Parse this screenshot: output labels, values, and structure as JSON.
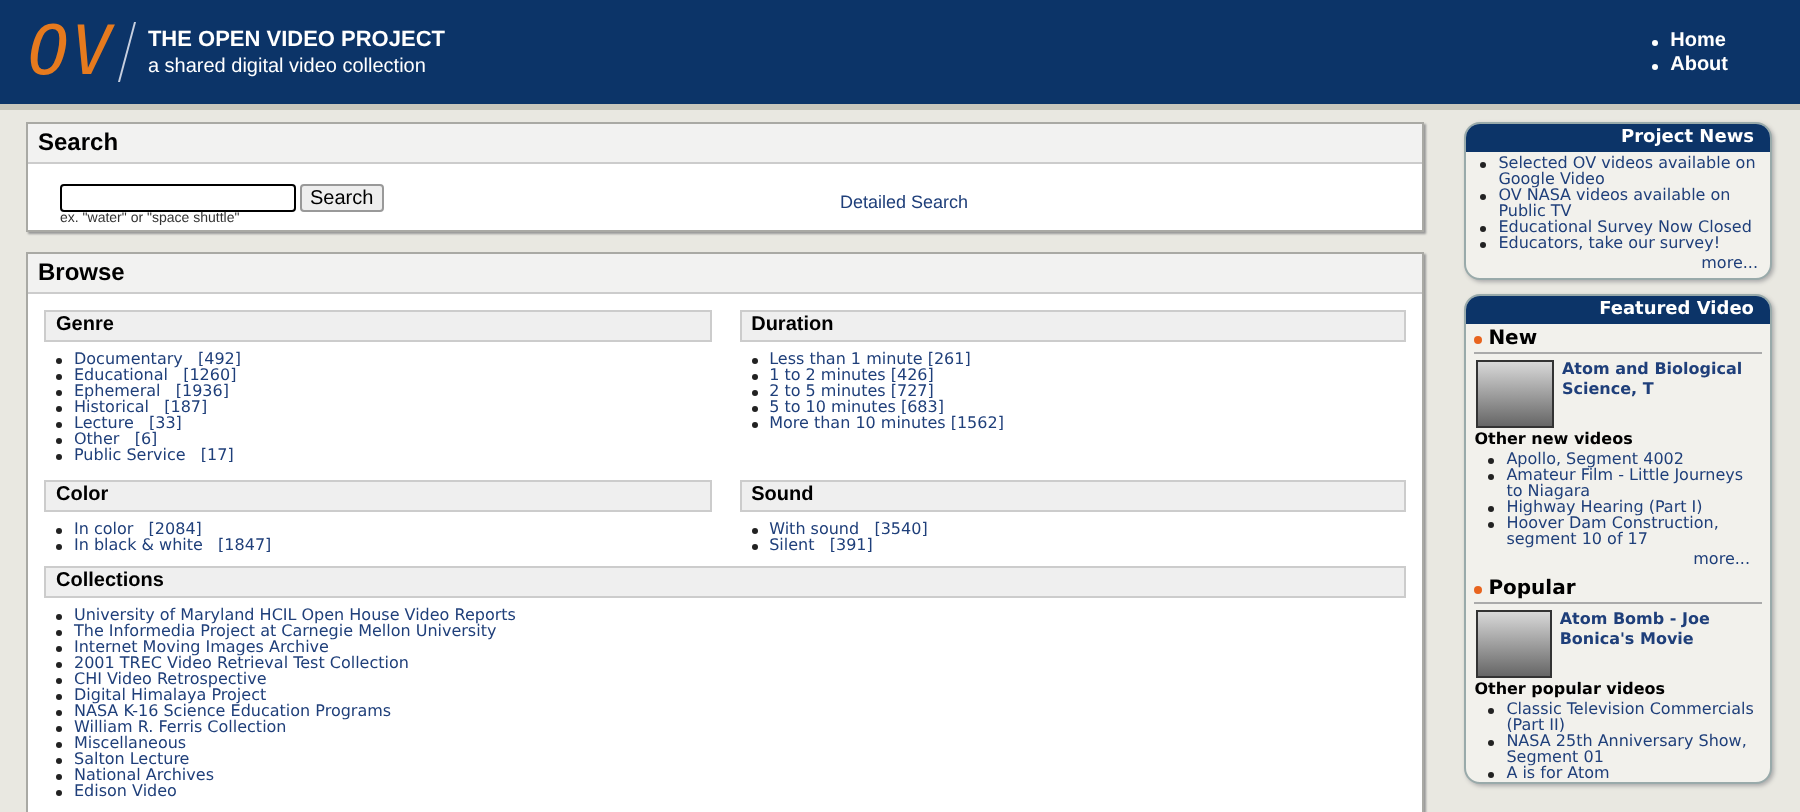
{
  "header": {
    "logo": "OV",
    "title": "THE OPEN VIDEO PROJECT",
    "subtitle": "a shared digital video collection",
    "nav": [
      "Home",
      "About"
    ]
  },
  "search": {
    "title": "Search",
    "button": "Search",
    "hint": "ex. \"water\" or \"space shuttle\"",
    "detailed_link": "Detailed Search"
  },
  "browse": {
    "title": "Browse",
    "sections": [
      {
        "title": "Genre",
        "items": [
          "Documentary   [492]",
          "Educational   [1260]",
          "Ephemeral   [1936]",
          "Historical   [187]",
          "Lecture   [33]",
          "Other   [6]",
          "Public Service   [17]"
        ]
      },
      {
        "title": "Duration",
        "items": [
          "Less than 1 minute [261]",
          "1 to 2 minutes [426]",
          "2 to 5 minutes [727]",
          "5 to 10 minutes [683]",
          "More than 10 minutes [1562]"
        ]
      },
      {
        "title": "Color",
        "items": [
          "In color   [2084]",
          "In black & white   [1847]"
        ]
      },
      {
        "title": "Sound",
        "items": [
          "With sound   [3540]",
          "Silent   [391]"
        ]
      }
    ],
    "collections": {
      "title": "Collections",
      "items": [
        "University of Maryland HCIL Open House Video Reports",
        "The Informedia Project at Carnegie Mellon University",
        "Internet Moving Images Archive",
        "2001 TREC Video Retrieval Test Collection",
        "CHI Video Retrospective",
        "Digital Himalaya Project",
        "NASA K-16 Science Education Programs",
        "William R. Ferris Collection",
        "Miscellaneous",
        "Salton Lecture",
        "National Archives",
        "Edison Video"
      ]
    }
  },
  "news": {
    "title": "Project News",
    "items": [
      "Selected OV videos available on Google Video",
      "OV NASA videos available on Public TV",
      "Educational Survey Now Closed",
      "Educators, take our survey!"
    ],
    "more": "more..."
  },
  "featured": {
    "title": "Featured Video",
    "groups": [
      {
        "title": "New",
        "video_title": "Atom and Biological Science, T",
        "other_title": "Other new videos",
        "others": [
          "Apollo, Segment 4002",
          "Amateur Film - Little Journeys to Niagara",
          "Highway Hearing (Part I)",
          "Hoover Dam Construction, segment 10 of 17"
        ],
        "more": "more..."
      },
      {
        "title": "Popular",
        "video_title": "Atom Bomb - Joe Bonica's Movie",
        "other_title": "Other popular videos",
        "others": [
          "Classic Television Commercials (Part II)",
          "NASA 25th Anniversary Show, Segment 01",
          "A is for Atom"
        ]
      }
    ]
  }
}
